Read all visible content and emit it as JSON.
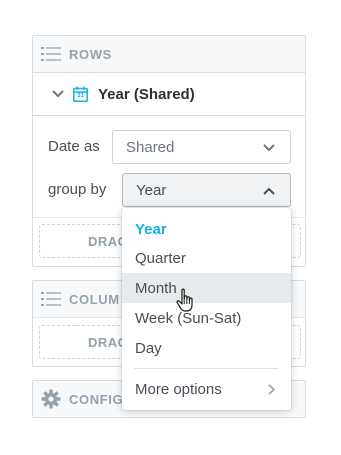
{
  "rows": {
    "header": "ROWS",
    "item": {
      "label": "Year (Shared)"
    },
    "date_as": {
      "label": "Date as",
      "value": "Shared"
    },
    "group_by": {
      "label": "group by",
      "value": "Year"
    },
    "drop_zone": "DRAG"
  },
  "columns": {
    "header": "COLUM",
    "drop_zone": "DRAG"
  },
  "configuration": {
    "header": "CONFIG"
  },
  "dropdown": {
    "options": [
      "Year",
      "Quarter",
      "Month",
      "Week (Sun-Sat)",
      "Day"
    ],
    "selected": "Year",
    "hovered": "Month",
    "more": "More options"
  },
  "calendar_day": "31",
  "colors": {
    "accent": "#14b2e2",
    "calendar": "#14b2e2",
    "border": "#d7dce1",
    "text": "#464e56",
    "muted": "#94a1ad",
    "hover": "#e8ebee"
  }
}
